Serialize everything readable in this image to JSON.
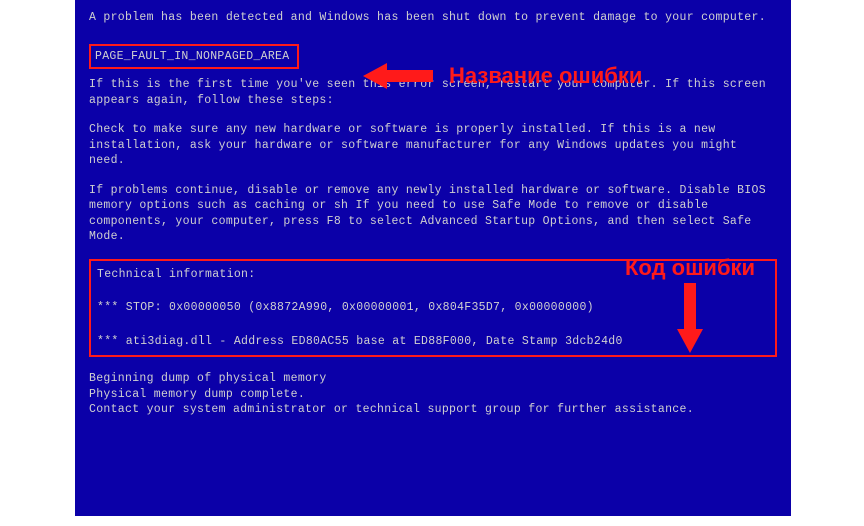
{
  "bsod": {
    "intro": "A problem has been detected and Windows has been shut down to prevent damage to your computer.",
    "error_name": "PAGE_FAULT_IN_NONPAGED_AREA",
    "para1": "If this is the first time you've seen this error screen, restart your computer. If this screen appears again, follow these steps:",
    "para2": "Check to make sure any new hardware or software is properly installed. If this is a new installation, ask your hardware or software manufacturer for any Windows updates you might need.",
    "para3": "If problems continue, disable or remove any newly installed hardware or software. Disable BIOS memory options such as caching or sh If you need to use Safe Mode to remove or disable components, your computer, press F8 to select Advanced Startup Options, and then select Safe Mode.",
    "tech_title": "Technical information:",
    "stop_line": "*** STOP: 0x00000050 (0x8872A990, 0x00000001, 0x804F35D7, 0x00000000)",
    "dll_line": "*** ati3diag.dll - Address ED80AC55 base at ED88F000, Date Stamp 3dcb24d0",
    "dump1": "Beginning dump of physical memory",
    "dump2": "Physical memory dump complete.",
    "dump3": "Contact your system administrator or technical support group for further assistance."
  },
  "annotations": {
    "error_name_label": "Название ошибки",
    "error_code_label": "Код ошибки"
  },
  "colors": {
    "bsod_bg": "#0b00a8",
    "bsod_text": "#d0d0d0",
    "highlight": "#ff1a1a"
  }
}
